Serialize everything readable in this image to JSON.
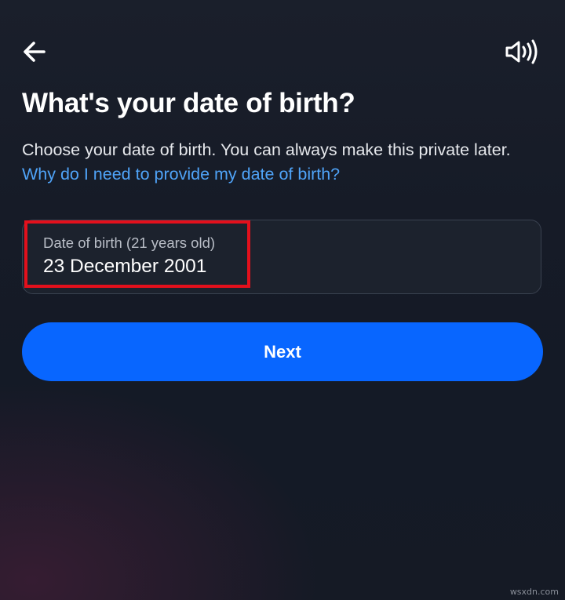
{
  "header": {
    "back_icon": "arrow-left-icon",
    "sound_icon": "speaker-volume-icon"
  },
  "page": {
    "title": "What's your date of birth?",
    "description": "Choose your date of birth. You can always make this private later.",
    "help_link": "Why do I need to provide my date of birth?"
  },
  "dob_field": {
    "label": "Date of birth (21 years old)",
    "value": "23 December 2001"
  },
  "actions": {
    "next_label": "Next"
  },
  "colors": {
    "background": "#161b27",
    "link": "#4fa3f7",
    "primary_button": "#0866ff",
    "highlight_annotation": "#e3101c",
    "field_border": "#3a4250"
  },
  "watermark": "wsxdn.com"
}
